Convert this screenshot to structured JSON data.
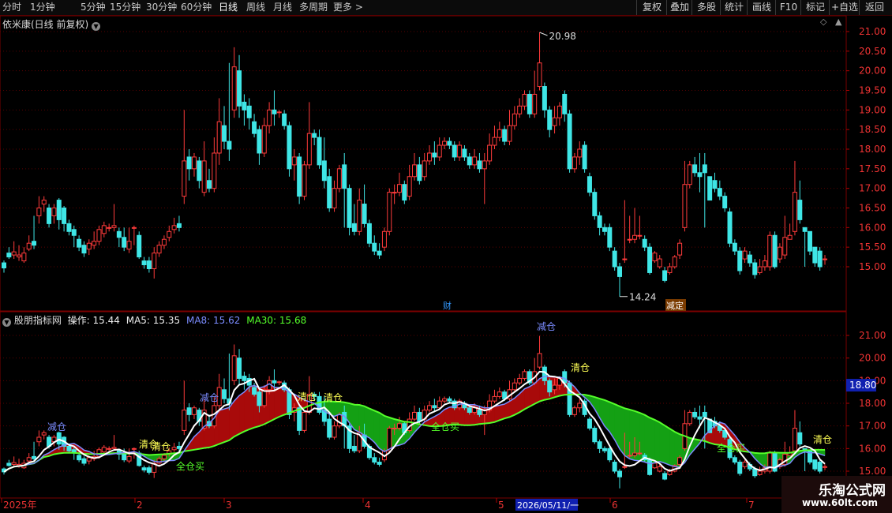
{
  "toolbar": {
    "periods": [
      "分时",
      "1分钟",
      "5分钟",
      "15分钟",
      "30分钟",
      "60分钟",
      "日线",
      "周线",
      "月线",
      "多周期",
      "更多 >"
    ],
    "active": "日线",
    "right_buttons": [
      "复权",
      "叠加",
      "多股",
      "统计",
      "画线",
      "F10",
      "标记",
      "+自选",
      "返回"
    ]
  },
  "main_header": {
    "title": "依米康(日线 前复权)"
  },
  "indicator_header": {
    "name": "股朋指标网",
    "op_label": "操作: 15.44",
    "ma5_label": "MA5: 15.35",
    "ma8_label": "MA8: 15.62",
    "ma30_label": "MA30: 15.68"
  },
  "colors": {
    "up": "#ff3b3b",
    "down": "#3fe6e6",
    "ma5": "#ffffff",
    "ma8": "#7b8cff",
    "ma30": "#55ff2a",
    "fill_up": "#a80a0a",
    "fill_down": "#14a014"
  },
  "main_axis": {
    "labels": [
      "21.00",
      "20.50",
      "20.00",
      "19.50",
      "19.00",
      "18.50",
      "18.00",
      "17.50",
      "17.00",
      "16.50",
      "16.00",
      "15.50",
      "15.00"
    ]
  },
  "sub_axis": {
    "labels": [
      "21.00",
      "20.00",
      "19.00",
      "18.00",
      "17.00",
      "16.00",
      "15.00"
    ],
    "cursor_value": "18.80"
  },
  "markers": {
    "high": "20.98",
    "low": "14.24",
    "fin": "财",
    "jian_ding": "减定"
  },
  "signals": [
    "减仓",
    "清仓",
    "清仓",
    "全仓买",
    "减仓",
    "清仓",
    "清仓",
    "全仓买",
    "减仓",
    "清仓",
    "全仓买",
    "清仓"
  ],
  "date_axis": [
    "2025年",
    "2",
    "3",
    "4",
    "5",
    "2026/05/11/一",
    "6",
    "7"
  ],
  "watermark": {
    "title": "乐淘公式网",
    "url": "www.60lt.com"
  },
  "chart_data": {
    "type": "candlestick",
    "series": [
      {
        "ohlc": [
          [
            15.1,
            14.97,
            14.85,
            15.16
          ],
          [
            15.35,
            15.25,
            15.2,
            15.5
          ],
          [
            15.3,
            15.38,
            15.2,
            15.65
          ],
          [
            15.25,
            15.3,
            15.15,
            15.55
          ],
          [
            15.15,
            15.35,
            15.1,
            15.5
          ],
          [
            15.45,
            15.6,
            15.4,
            15.8
          ],
          [
            15.65,
            15.55,
            15.45,
            16.3
          ],
          [
            16.3,
            16.5,
            16.1,
            16.8
          ],
          [
            16.6,
            16.7,
            16.4,
            16.8
          ],
          [
            16.5,
            16.1,
            16.0,
            16.6
          ],
          [
            16.3,
            16.5,
            16.1,
            16.6
          ],
          [
            16.7,
            16.2,
            15.95,
            16.75
          ],
          [
            16.5,
            16.1,
            15.9,
            16.55
          ],
          [
            16.1,
            15.9,
            15.8,
            16.2
          ],
          [
            15.95,
            15.8,
            15.5,
            16.05
          ],
          [
            15.7,
            15.5,
            15.4,
            15.8
          ],
          [
            15.55,
            15.35,
            15.25,
            15.65
          ],
          [
            15.45,
            15.6,
            15.3,
            15.7
          ],
          [
            15.55,
            15.65,
            15.45,
            15.9
          ],
          [
            15.65,
            15.95,
            15.55,
            16.05
          ],
          [
            15.85,
            16.05,
            15.75,
            16.15
          ],
          [
            16.0,
            16.0,
            15.9,
            16.1
          ],
          [
            16.0,
            16.05,
            15.9,
            16.6
          ],
          [
            15.9,
            15.75,
            15.5,
            16.0
          ],
          [
            15.75,
            15.5,
            15.4,
            16.0
          ],
          [
            15.45,
            15.65,
            15.35,
            16.0
          ],
          [
            16.0,
            16.0,
            15.55,
            16.05
          ],
          [
            15.8,
            15.25,
            15.2,
            15.9
          ],
          [
            15.15,
            15.05,
            14.95,
            15.25
          ],
          [
            15.15,
            14.95,
            14.85,
            15.25
          ],
          [
            14.95,
            15.35,
            14.7,
            15.5
          ],
          [
            15.35,
            15.55,
            15.25,
            15.65
          ],
          [
            15.55,
            15.7,
            15.45,
            15.8
          ],
          [
            15.75,
            15.9,
            15.65,
            16.05
          ],
          [
            15.95,
            16.05,
            15.85,
            16.25
          ],
          [
            16.1,
            16.0,
            15.9,
            16.3
          ],
          [
            16.8,
            17.7,
            16.6,
            19.0
          ],
          [
            17.8,
            17.5,
            17.2,
            18.0
          ],
          [
            17.5,
            17.8,
            17.3,
            17.9
          ],
          [
            17.7,
            17.2,
            17.0,
            17.8
          ],
          [
            16.9,
            17.7,
            16.8,
            18.2
          ],
          [
            17.2,
            17.0,
            16.9,
            17.5
          ],
          [
            17.0,
            17.9,
            16.9,
            18.3
          ],
          [
            17.9,
            18.7,
            17.6,
            19.3
          ],
          [
            18.6,
            18.2,
            18.0,
            19.1
          ],
          [
            18.2,
            18.0,
            17.7,
            20.2
          ],
          [
            19.0,
            20.1,
            18.8,
            20.6
          ],
          [
            20.0,
            19.1,
            18.8,
            20.4
          ],
          [
            19.2,
            19.0,
            18.6,
            19.4
          ],
          [
            19.1,
            18.8,
            18.5,
            19.3
          ],
          [
            18.7,
            18.4,
            18.3,
            18.9
          ],
          [
            18.5,
            17.9,
            17.6,
            18.6
          ],
          [
            17.9,
            18.6,
            17.8,
            18.8
          ],
          [
            18.6,
            19.0,
            18.4,
            19.2
          ],
          [
            19.0,
            18.9,
            18.6,
            19.5
          ],
          [
            18.95,
            18.95,
            18.8,
            19.0
          ],
          [
            18.9,
            18.6,
            18.5,
            19.0
          ],
          [
            18.6,
            17.5,
            17.3,
            18.7
          ],
          [
            17.6,
            17.8,
            17.2,
            18.0
          ],
          [
            17.8,
            16.8,
            16.6,
            17.9
          ],
          [
            16.8,
            17.6,
            16.7,
            17.7
          ],
          [
            17.6,
            18.4,
            17.5,
            19.2
          ],
          [
            18.4,
            18.3,
            18.1,
            18.5
          ],
          [
            18.3,
            17.6,
            17.5,
            18.5
          ],
          [
            17.7,
            17.2,
            17.0,
            18.3
          ],
          [
            17.3,
            16.5,
            16.4,
            17.5
          ],
          [
            16.5,
            17.0,
            16.4,
            17.2
          ],
          [
            17.0,
            17.5,
            16.9,
            17.6
          ],
          [
            17.6,
            17.0,
            16.0,
            17.9
          ],
          [
            17.0,
            16.0,
            15.8,
            17.1
          ],
          [
            16.1,
            15.9,
            15.8,
            16.6
          ],
          [
            15.9,
            16.7,
            15.8,
            17.0
          ],
          [
            16.6,
            16.1,
            16.0,
            17.1
          ],
          [
            16.1,
            15.6,
            15.5,
            16.2
          ],
          [
            15.6,
            15.4,
            15.3,
            15.8
          ],
          [
            15.4,
            15.3,
            15.2,
            15.6
          ],
          [
            15.5,
            15.9,
            15.4,
            16.0
          ],
          [
            15.9,
            16.9,
            15.8,
            17.0
          ],
          [
            16.9,
            16.9,
            16.6,
            17.1
          ],
          [
            16.9,
            17.1,
            16.8,
            17.4
          ],
          [
            17.1,
            16.7,
            16.6,
            17.2
          ],
          [
            16.8,
            17.3,
            16.7,
            17.6
          ],
          [
            17.3,
            17.6,
            17.2,
            17.9
          ],
          [
            17.6,
            17.2,
            17.1,
            17.8
          ],
          [
            17.3,
            17.7,
            17.2,
            17.9
          ],
          [
            17.7,
            17.9,
            17.6,
            18.1
          ],
          [
            17.9,
            17.8,
            17.6,
            18.2
          ],
          [
            17.8,
            18.1,
            17.7,
            18.3
          ],
          [
            18.1,
            18.2,
            18.0,
            18.3
          ],
          [
            18.2,
            18.1,
            18.0,
            18.3
          ],
          [
            18.1,
            17.8,
            17.7,
            18.2
          ],
          [
            17.8,
            18.1,
            17.7,
            18.2
          ],
          [
            18.0,
            17.8,
            17.7,
            18.1
          ],
          [
            17.8,
            17.6,
            17.5,
            17.9
          ],
          [
            17.6,
            17.8,
            17.5,
            18.0
          ],
          [
            17.7,
            17.5,
            17.4,
            17.9
          ],
          [
            17.5,
            17.7,
            16.6,
            17.9
          ],
          [
            17.7,
            18.1,
            17.6,
            18.4
          ],
          [
            18.1,
            18.3,
            18.0,
            18.6
          ],
          [
            18.3,
            18.5,
            18.2,
            18.7
          ],
          [
            18.5,
            18.2,
            18.1,
            18.6
          ],
          [
            18.2,
            18.6,
            18.1,
            19.0
          ],
          [
            18.6,
            18.9,
            18.5,
            19.1
          ],
          [
            18.9,
            19.1,
            18.8,
            19.3
          ],
          [
            19.1,
            19.4,
            19.0,
            19.5
          ],
          [
            19.4,
            18.9,
            18.8,
            19.5
          ],
          [
            18.9,
            19.4,
            18.8,
            20.0
          ],
          [
            19.6,
            20.2,
            19.5,
            20.98
          ],
          [
            19.6,
            19.0,
            18.8,
            19.7
          ],
          [
            19.0,
            18.5,
            18.3,
            19.1
          ],
          [
            18.6,
            18.8,
            18.4,
            19.1
          ],
          [
            18.8,
            19.1,
            18.6,
            19.2
          ],
          [
            19.4,
            18.9,
            18.7,
            19.5
          ],
          [
            18.9,
            17.5,
            17.4,
            19.0
          ],
          [
            17.5,
            17.8,
            17.4,
            17.9
          ],
          [
            17.8,
            18.0,
            17.6,
            18.2
          ],
          [
            18.1,
            17.5,
            17.4,
            18.2
          ],
          [
            17.3,
            16.9,
            16.8,
            17.4
          ],
          [
            16.9,
            16.3,
            16.2,
            17.0
          ],
          [
            16.3,
            16.0,
            15.8,
            16.4
          ],
          [
            16.0,
            15.9,
            15.8,
            16.1
          ],
          [
            16.0,
            15.5,
            15.4,
            16.1
          ],
          [
            15.4,
            15.0,
            14.9,
            15.5
          ],
          [
            15.0,
            14.75,
            14.24,
            15.1
          ],
          [
            15.2,
            15.2,
            15.1,
            16.7
          ],
          [
            15.7,
            15.7,
            15.6,
            16.3
          ],
          [
            15.7,
            15.8,
            15.6,
            16.5
          ],
          [
            15.8,
            15.8,
            15.7,
            16.3
          ],
          [
            15.7,
            15.5,
            15.4,
            15.8
          ],
          [
            15.5,
            14.85,
            14.8,
            15.6
          ],
          [
            15.15,
            15.35,
            15.1,
            15.4
          ],
          [
            15.0,
            15.2,
            14.95,
            15.3
          ],
          [
            14.9,
            14.65,
            14.6,
            15.0
          ],
          [
            14.85,
            15.0,
            14.8,
            15.1
          ],
          [
            15.0,
            15.25,
            14.95,
            15.3
          ],
          [
            15.3,
            15.6,
            15.2,
            15.7
          ],
          [
            16.0,
            17.1,
            15.9,
            17.7
          ],
          [
            17.1,
            17.6,
            17.0,
            17.7
          ],
          [
            17.6,
            17.4,
            17.3,
            17.8
          ],
          [
            17.4,
            17.3,
            16.9,
            17.9
          ],
          [
            17.6,
            17.4,
            16.0,
            17.9
          ],
          [
            17.3,
            16.7,
            17.2,
            17.2
          ],
          [
            17.2,
            17.0,
            16.9,
            17.4
          ],
          [
            17.0,
            16.8,
            16.7,
            17.2
          ],
          [
            16.8,
            16.5,
            16.4,
            16.9
          ],
          [
            16.4,
            15.6,
            15.5,
            16.5
          ],
          [
            15.6,
            15.4,
            15.3,
            15.7
          ],
          [
            15.4,
            14.9,
            14.8,
            15.5
          ],
          [
            15.2,
            15.4,
            15.1,
            15.5
          ],
          [
            15.3,
            15.1,
            15.0,
            15.4
          ],
          [
            15.1,
            14.8,
            14.7,
            15.2
          ],
          [
            14.85,
            15.0,
            14.8,
            15.2
          ],
          [
            15.0,
            15.15,
            14.9,
            15.3
          ],
          [
            15.0,
            15.8,
            14.9,
            15.9
          ],
          [
            15.8,
            15.0,
            14.95,
            15.9
          ],
          [
            15.2,
            15.5,
            15.1,
            15.6
          ],
          [
            15.3,
            15.75,
            15.2,
            16.3
          ],
          [
            15.7,
            15.8,
            15.7,
            16.1
          ],
          [
            15.9,
            16.9,
            15.8,
            17.7
          ],
          [
            16.7,
            16.2,
            16.1,
            17.2
          ],
          [
            16.0,
            15.9,
            15.0,
            16.0
          ],
          [
            15.9,
            15.4,
            15.3,
            15.9
          ],
          [
            15.5,
            15.1,
            15.0,
            15.5
          ],
          [
            15.4,
            15.0,
            14.9,
            15.5
          ],
          [
            15.2,
            15.2,
            15.05,
            15.3
          ]
        ]
      }
    ]
  }
}
